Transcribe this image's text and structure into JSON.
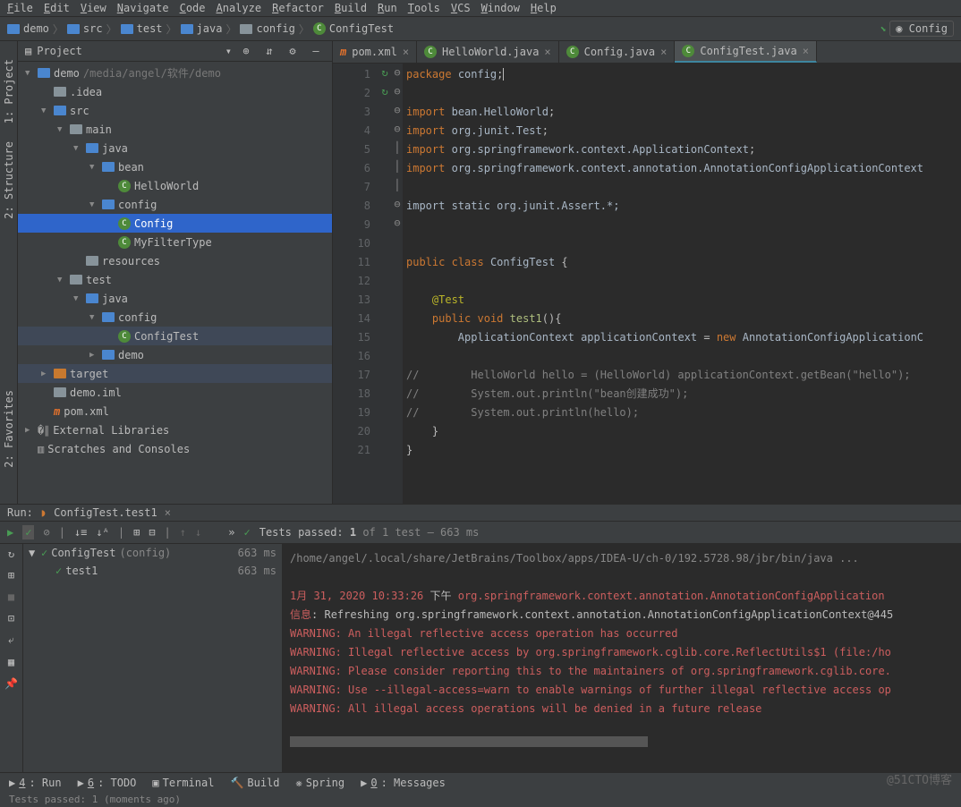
{
  "menubar": [
    "File",
    "Edit",
    "View",
    "Navigate",
    "Code",
    "Analyze",
    "Refactor",
    "Build",
    "Run",
    "Tools",
    "VCS",
    "Window",
    "Help"
  ],
  "breadcrumb": [
    "demo",
    "src",
    "test",
    "java",
    "config",
    "ConfigTest"
  ],
  "topright_label": "Config",
  "project_header": {
    "title": "Project"
  },
  "tree": [
    {
      "indent": 0,
      "arrow": "▼",
      "icon": "folder-blue",
      "label": "demo",
      "path": "/media/angel/软件/demo"
    },
    {
      "indent": 1,
      "arrow": "",
      "icon": "folder",
      "label": ".idea"
    },
    {
      "indent": 1,
      "arrow": "▼",
      "icon": "folder-blue",
      "label": "src"
    },
    {
      "indent": 2,
      "arrow": "▼",
      "icon": "folder",
      "label": "main"
    },
    {
      "indent": 3,
      "arrow": "▼",
      "icon": "folder-blue",
      "label": "java"
    },
    {
      "indent": 4,
      "arrow": "▼",
      "icon": "folder-blue",
      "label": "bean"
    },
    {
      "indent": 5,
      "arrow": "",
      "icon": "class",
      "label": "HelloWorld"
    },
    {
      "indent": 4,
      "arrow": "▼",
      "icon": "folder-blue",
      "label": "config"
    },
    {
      "indent": 5,
      "arrow": "",
      "icon": "class",
      "label": "Config",
      "selected": true
    },
    {
      "indent": 5,
      "arrow": "",
      "icon": "class",
      "label": "MyFilterType"
    },
    {
      "indent": 3,
      "arrow": "",
      "icon": "folder",
      "label": "resources"
    },
    {
      "indent": 2,
      "arrow": "▼",
      "icon": "folder",
      "label": "test"
    },
    {
      "indent": 3,
      "arrow": "▼",
      "icon": "folder-blue",
      "label": "java"
    },
    {
      "indent": 4,
      "arrow": "▼",
      "icon": "folder-blue",
      "label": "config"
    },
    {
      "indent": 5,
      "arrow": "",
      "icon": "class",
      "label": "ConfigTest",
      "dim": true
    },
    {
      "indent": 4,
      "arrow": "▶",
      "icon": "folder-blue",
      "label": "demo"
    },
    {
      "indent": 1,
      "arrow": "▶",
      "icon": "folder-orange",
      "label": "target",
      "dim": true
    },
    {
      "indent": 1,
      "arrow": "",
      "icon": "file",
      "label": "demo.iml"
    },
    {
      "indent": 1,
      "arrow": "",
      "icon": "maven",
      "label": "pom.xml"
    },
    {
      "indent": 0,
      "arrow": "▶",
      "icon": "lib",
      "label": "External Libraries"
    },
    {
      "indent": 0,
      "arrow": "",
      "icon": "scratch",
      "label": "Scratches and Consoles"
    }
  ],
  "editor_tabs": [
    {
      "icon": "maven",
      "label": "pom.xml",
      "active": false
    },
    {
      "icon": "class",
      "label": "HelloWorld.java",
      "active": false
    },
    {
      "icon": "class",
      "label": "Config.java",
      "active": false
    },
    {
      "icon": "class",
      "label": "ConfigTest.java",
      "active": true
    }
  ],
  "line_numbers": [
    1,
    2,
    3,
    4,
    5,
    6,
    7,
    8,
    9,
    10,
    11,
    12,
    13,
    14,
    15,
    16,
    17,
    18,
    19,
    20,
    21
  ],
  "gutter_marks": {
    "11": "↻",
    "14": "↻"
  },
  "fold_marks": {
    "3": "⊖",
    "8": "⊖",
    "11": "⊖",
    "14": "⊖",
    "17": "│",
    "18": "│",
    "19": "│",
    "20": "⊖",
    "21": "⊖"
  },
  "code": {
    "l1": {
      "kw": "package",
      "sp": " ",
      "id": "config",
      "semi": ";"
    },
    "l3": {
      "kw": "import",
      "sp": " ",
      "id": "bean.HelloWorld",
      "semi": ";"
    },
    "l4": {
      "kw": "import",
      "sp": " ",
      "pkg": "org.junit.",
      "cls": "Test",
      "semi": ";"
    },
    "l5": {
      "kw": "import",
      "sp": " ",
      "pkg": "org.springframework.context.",
      "cls": "ApplicationContext",
      "semi": ";"
    },
    "l6": {
      "kw": "import",
      "sp": " ",
      "pkg": "org.springframework.context.annotation.",
      "cls": "AnnotationConfigApplicationContext"
    },
    "l8": {
      "txt": "import static org.junit.Assert.*;"
    },
    "l11": {
      "kw1": "public",
      "sp1": " ",
      "kw2": "class",
      "sp2": " ",
      "name": "ConfigTest",
      "brace": " {"
    },
    "l13": {
      "ann": "    @Test"
    },
    "l14": {
      "indent": "    ",
      "kw1": "public",
      "sp1": " ",
      "kw2": "void",
      "sp2": " ",
      "name": "test1",
      "paren": "(){"
    },
    "l15": {
      "indent": "        ",
      "type": "ApplicationContext",
      "sp": " ",
      "var": "applicationContext",
      "eq": " = ",
      "kw": "new",
      "sp2": " ",
      "cls": "AnnotationConfigApplicationC"
    },
    "l17": {
      "c": "//        HelloWorld hello = (HelloWorld) applicationContext.getBean(\"hello\");"
    },
    "l18": {
      "c": "//        System.out.println(\"bean创建成功\");"
    },
    "l19": {
      "c": "//        System.out.println(hello);"
    },
    "l20": {
      "brace": "    }"
    },
    "l21": {
      "brace": "}"
    }
  },
  "run": {
    "title": "Run:",
    "config_label": "ConfigTest.test1",
    "tests_passed_prefix": "Tests passed: ",
    "tests_passed_count": "1",
    "tests_passed_suffix": " of 1 test – 663 ms",
    "tree": [
      {
        "arrow": "▼",
        "status": "✓",
        "name": "ConfigTest",
        "config": "(config)",
        "time": "663 ms"
      },
      {
        "arrow": "",
        "status": "✓",
        "name": "test1",
        "config": "",
        "time": "663 ms"
      }
    ],
    "console": {
      "cmd": "/home/angel/.local/share/JetBrains/Toolbox/apps/IDEA-U/ch-0/192.5728.98/jbr/bin/java ...",
      "l1a": "1月 31, 2020 10:33:26 ",
      "l1b": "下午 ",
      "l1c": "org.springframework.context.annotation.AnnotationConfigApplication",
      "l2a": "信息",
      "l2b": ": Refreshing org.springframework.context.annotation.AnnotationConfigApplicationContext@445",
      "l3": "WARNING: An illegal reflective access operation has occurred",
      "l4": "WARNING: Illegal reflective access by org.springframework.cglib.core.ReflectUtils$1 (file:/ho",
      "l5": "WARNING: Please consider reporting this to the maintainers of org.springframework.cglib.core.",
      "l6": "WARNING: Use --illegal-access=warn to enable warnings of further illegal reflective access op",
      "l7": "WARNING: All illegal access operations will be denied in a future release"
    }
  },
  "statusbar": [
    {
      "u": "4",
      "label": ": Run"
    },
    {
      "u": "6",
      "label": ": TODO"
    },
    {
      "icon": "▣",
      "label": "Terminal"
    },
    {
      "icon": "🔨",
      "label": "Build"
    },
    {
      "icon": "❋",
      "label": "Spring"
    },
    {
      "u": "0",
      "label": ": Messages"
    }
  ],
  "status_msg": "Tests passed: 1 (moments ago)",
  "watermark": "@51CTO博客",
  "left_gutter": [
    "1: Project",
    "2: Structure",
    "2: Favorites"
  ]
}
